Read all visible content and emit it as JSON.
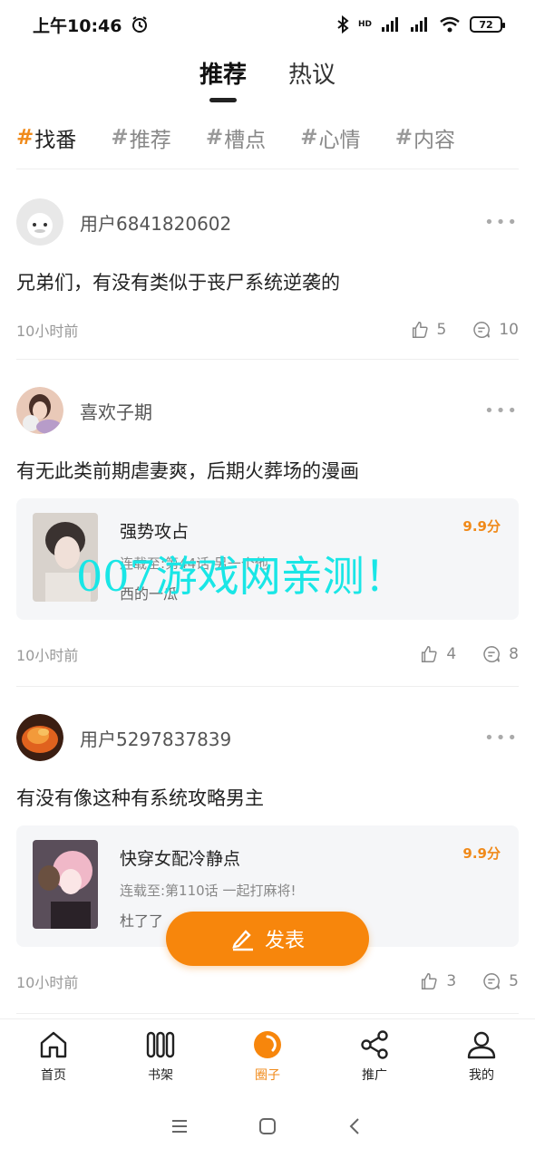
{
  "status": {
    "time": "上午10:46",
    "battery": "72",
    "network": "HD"
  },
  "top_tabs": [
    {
      "label": "推荐",
      "active": true
    },
    {
      "label": "热议",
      "active": false
    }
  ],
  "hashtags": [
    {
      "label": "找番",
      "active": true
    },
    {
      "label": "推荐",
      "active": false
    },
    {
      "label": "槽点",
      "active": false
    },
    {
      "label": "心情",
      "active": false
    },
    {
      "label": "内容",
      "active": false
    }
  ],
  "posts": [
    {
      "user": "用户6841820602",
      "text": "兄弟们，有没有类似于丧尸系统逆袭的",
      "time": "10小时前",
      "likes": "5",
      "comments": "10"
    },
    {
      "user": "喜欢子期",
      "text": "有无此类前期虐妻爽，后期火葬场的漫画",
      "time": "10小时前",
      "likes": "4",
      "comments": "8",
      "book": {
        "title": "强势攻占",
        "progress": "连载至:第44话 另一个他",
        "note": "西的一瓜",
        "score": "9.9分"
      }
    },
    {
      "user": "用户5297837839",
      "text": "有没有像这种有系统攻略男主",
      "time": "10小时前",
      "likes": "3",
      "comments": "5",
      "book": {
        "title": "快穿女配冷静点",
        "progress": "连载至:第110话 一起打麻将!",
        "note": "杜了了",
        "score": "9.9分"
      }
    }
  ],
  "watermark": "007游戏网亲测！",
  "fab": {
    "label": "发表"
  },
  "bottom_nav": [
    {
      "label": "首页",
      "icon": "home-icon"
    },
    {
      "label": "书架",
      "icon": "bookshelf-icon"
    },
    {
      "label": "圈子",
      "icon": "circle-icon",
      "active": true
    },
    {
      "label": "推广",
      "icon": "share-icon"
    },
    {
      "label": "我的",
      "icon": "user-icon"
    }
  ],
  "colors": {
    "accent": "#f7860c",
    "watermark": "#19e6e6"
  }
}
